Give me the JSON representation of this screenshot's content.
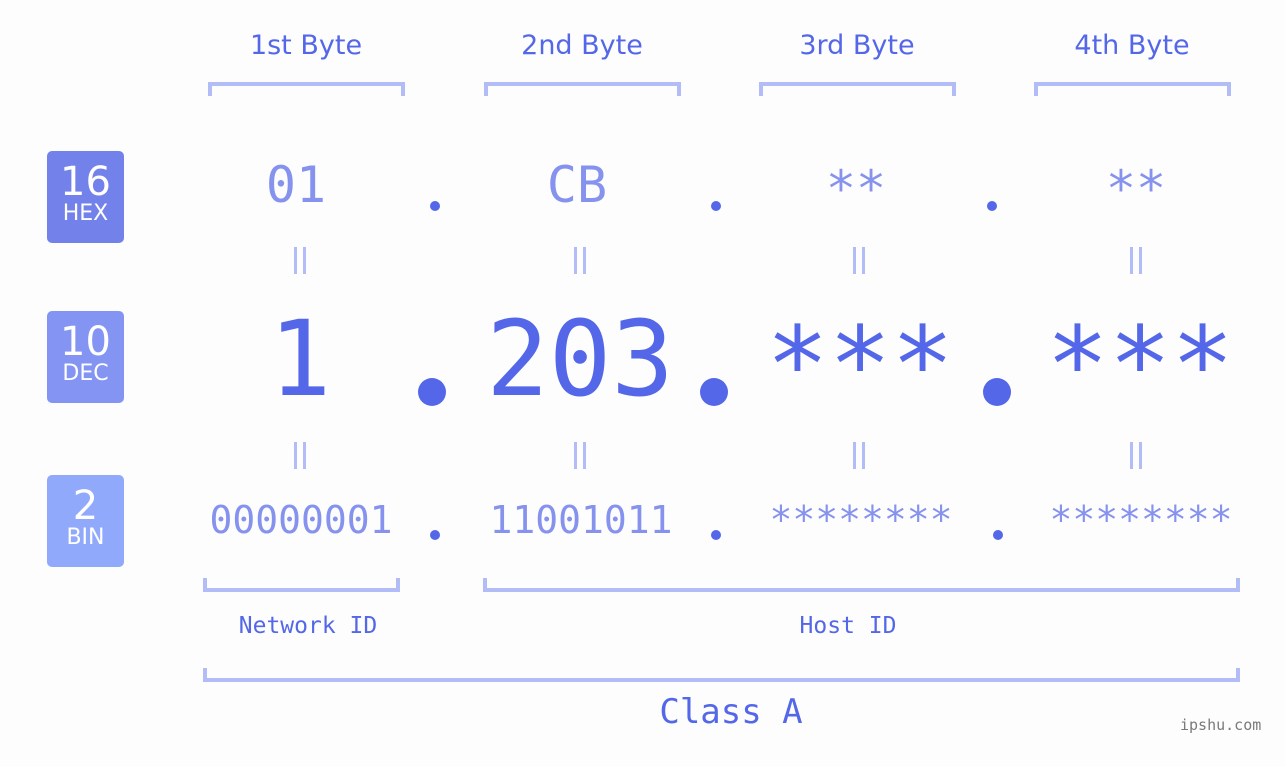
{
  "headers": [
    "1st Byte",
    "2nd Byte",
    "3rd Byte",
    "4th Byte"
  ],
  "bases": [
    {
      "number": "16",
      "label": "HEX",
      "color": "#7381ea"
    },
    {
      "number": "10",
      "label": "DEC",
      "color": "#8494f2"
    },
    {
      "number": "2",
      "label": "BIN",
      "color": "#91a9fb"
    }
  ],
  "hex": [
    "01",
    "CB",
    "**",
    "**"
  ],
  "dec": [
    "1",
    "203",
    "***",
    "***"
  ],
  "bin": [
    "00000001",
    "11001011",
    "********",
    "********"
  ],
  "network_label": "Network ID",
  "host_label": "Host ID",
  "class_label": "Class A",
  "watermark": "ipshu.com",
  "colors": {
    "primary": "#5467e8",
    "secondary": "#8592ee",
    "bracket": "#b2bdf7"
  }
}
